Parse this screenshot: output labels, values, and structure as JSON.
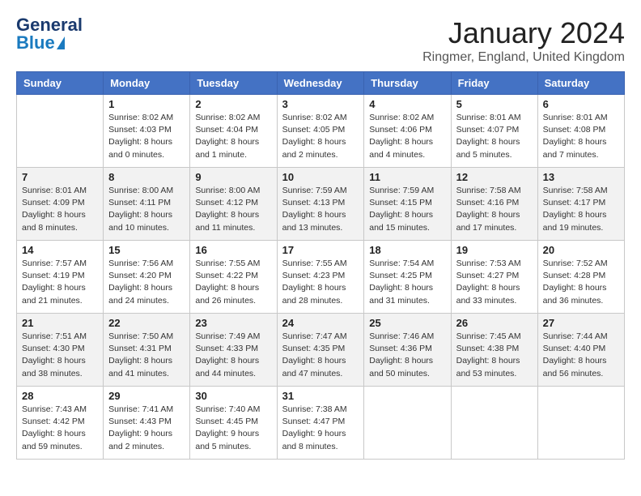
{
  "logo": {
    "general": "General",
    "blue": "Blue"
  },
  "title": "January 2024",
  "location": "Ringmer, England, United Kingdom",
  "headers": [
    "Sunday",
    "Monday",
    "Tuesday",
    "Wednesday",
    "Thursday",
    "Friday",
    "Saturday"
  ],
  "weeks": [
    [
      {
        "day": "",
        "info": ""
      },
      {
        "day": "1",
        "info": "Sunrise: 8:02 AM\nSunset: 4:03 PM\nDaylight: 8 hours\nand 0 minutes."
      },
      {
        "day": "2",
        "info": "Sunrise: 8:02 AM\nSunset: 4:04 PM\nDaylight: 8 hours\nand 1 minute."
      },
      {
        "day": "3",
        "info": "Sunrise: 8:02 AM\nSunset: 4:05 PM\nDaylight: 8 hours\nand 2 minutes."
      },
      {
        "day": "4",
        "info": "Sunrise: 8:02 AM\nSunset: 4:06 PM\nDaylight: 8 hours\nand 4 minutes."
      },
      {
        "day": "5",
        "info": "Sunrise: 8:01 AM\nSunset: 4:07 PM\nDaylight: 8 hours\nand 5 minutes."
      },
      {
        "day": "6",
        "info": "Sunrise: 8:01 AM\nSunset: 4:08 PM\nDaylight: 8 hours\nand 7 minutes."
      }
    ],
    [
      {
        "day": "7",
        "info": "Sunrise: 8:01 AM\nSunset: 4:09 PM\nDaylight: 8 hours\nand 8 minutes."
      },
      {
        "day": "8",
        "info": "Sunrise: 8:00 AM\nSunset: 4:11 PM\nDaylight: 8 hours\nand 10 minutes."
      },
      {
        "day": "9",
        "info": "Sunrise: 8:00 AM\nSunset: 4:12 PM\nDaylight: 8 hours\nand 11 minutes."
      },
      {
        "day": "10",
        "info": "Sunrise: 7:59 AM\nSunset: 4:13 PM\nDaylight: 8 hours\nand 13 minutes."
      },
      {
        "day": "11",
        "info": "Sunrise: 7:59 AM\nSunset: 4:15 PM\nDaylight: 8 hours\nand 15 minutes."
      },
      {
        "day": "12",
        "info": "Sunrise: 7:58 AM\nSunset: 4:16 PM\nDaylight: 8 hours\nand 17 minutes."
      },
      {
        "day": "13",
        "info": "Sunrise: 7:58 AM\nSunset: 4:17 PM\nDaylight: 8 hours\nand 19 minutes."
      }
    ],
    [
      {
        "day": "14",
        "info": "Sunrise: 7:57 AM\nSunset: 4:19 PM\nDaylight: 8 hours\nand 21 minutes."
      },
      {
        "day": "15",
        "info": "Sunrise: 7:56 AM\nSunset: 4:20 PM\nDaylight: 8 hours\nand 24 minutes."
      },
      {
        "day": "16",
        "info": "Sunrise: 7:55 AM\nSunset: 4:22 PM\nDaylight: 8 hours\nand 26 minutes."
      },
      {
        "day": "17",
        "info": "Sunrise: 7:55 AM\nSunset: 4:23 PM\nDaylight: 8 hours\nand 28 minutes."
      },
      {
        "day": "18",
        "info": "Sunrise: 7:54 AM\nSunset: 4:25 PM\nDaylight: 8 hours\nand 31 minutes."
      },
      {
        "day": "19",
        "info": "Sunrise: 7:53 AM\nSunset: 4:27 PM\nDaylight: 8 hours\nand 33 minutes."
      },
      {
        "day": "20",
        "info": "Sunrise: 7:52 AM\nSunset: 4:28 PM\nDaylight: 8 hours\nand 36 minutes."
      }
    ],
    [
      {
        "day": "21",
        "info": "Sunrise: 7:51 AM\nSunset: 4:30 PM\nDaylight: 8 hours\nand 38 minutes."
      },
      {
        "day": "22",
        "info": "Sunrise: 7:50 AM\nSunset: 4:31 PM\nDaylight: 8 hours\nand 41 minutes."
      },
      {
        "day": "23",
        "info": "Sunrise: 7:49 AM\nSunset: 4:33 PM\nDaylight: 8 hours\nand 44 minutes."
      },
      {
        "day": "24",
        "info": "Sunrise: 7:47 AM\nSunset: 4:35 PM\nDaylight: 8 hours\nand 47 minutes."
      },
      {
        "day": "25",
        "info": "Sunrise: 7:46 AM\nSunset: 4:36 PM\nDaylight: 8 hours\nand 50 minutes."
      },
      {
        "day": "26",
        "info": "Sunrise: 7:45 AM\nSunset: 4:38 PM\nDaylight: 8 hours\nand 53 minutes."
      },
      {
        "day": "27",
        "info": "Sunrise: 7:44 AM\nSunset: 4:40 PM\nDaylight: 8 hours\nand 56 minutes."
      }
    ],
    [
      {
        "day": "28",
        "info": "Sunrise: 7:43 AM\nSunset: 4:42 PM\nDaylight: 8 hours\nand 59 minutes."
      },
      {
        "day": "29",
        "info": "Sunrise: 7:41 AM\nSunset: 4:43 PM\nDaylight: 9 hours\nand 2 minutes."
      },
      {
        "day": "30",
        "info": "Sunrise: 7:40 AM\nSunset: 4:45 PM\nDaylight: 9 hours\nand 5 minutes."
      },
      {
        "day": "31",
        "info": "Sunrise: 7:38 AM\nSunset: 4:47 PM\nDaylight: 9 hours\nand 8 minutes."
      },
      {
        "day": "",
        "info": ""
      },
      {
        "day": "",
        "info": ""
      },
      {
        "day": "",
        "info": ""
      }
    ]
  ]
}
